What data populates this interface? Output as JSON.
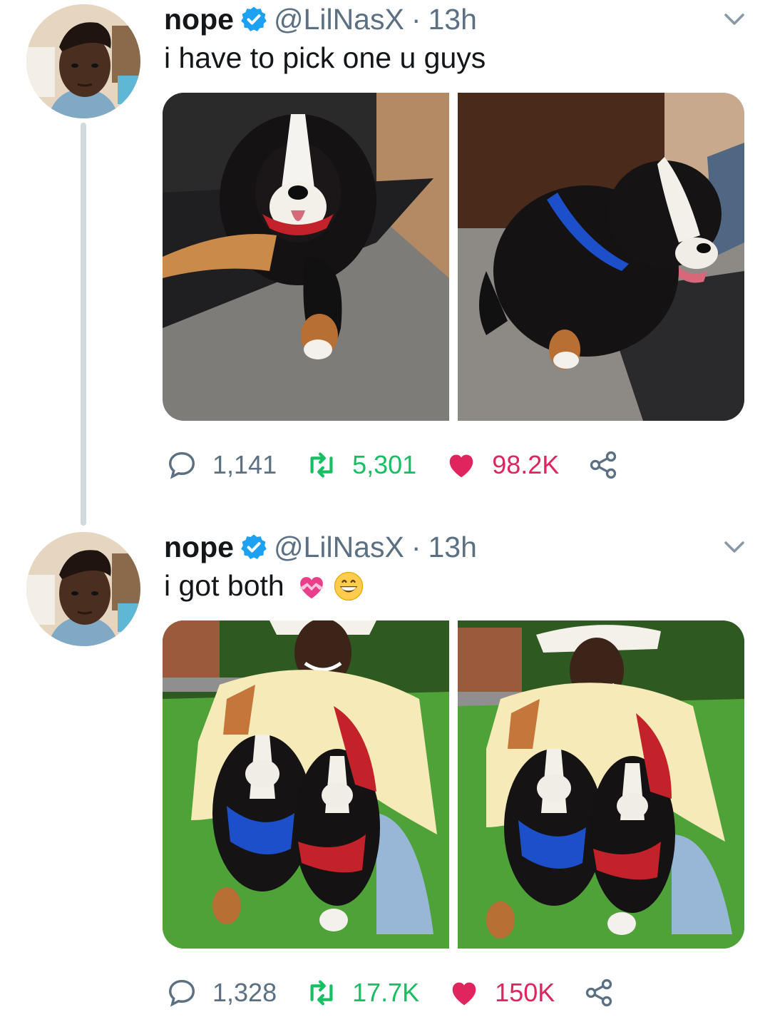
{
  "tweets": [
    {
      "display_name": "nope",
      "handle": "@LilNasX",
      "separator": "·",
      "time": "13h",
      "text": "i have to pick one u guys",
      "emojis": [],
      "photos": [
        "bernese-puppy-red-harness-lying",
        "bernese-puppy-blue-harness-sitting"
      ],
      "replies": "1,141",
      "retweets": "5,301",
      "likes": "98.2K",
      "liked": true
    },
    {
      "display_name": "nope",
      "handle": "@LilNasX",
      "separator": "·",
      "time": "13h",
      "text": "i got both",
      "emojis": [
        "heart-with-ribbon-emoji",
        "grinning-face-emoji"
      ],
      "photos": [
        "man-in-cowboy-hat-with-two-puppies",
        "man-in-cowboy-hat-with-two-puppies-2"
      ],
      "replies": "1,328",
      "retweets": "17.7K",
      "likes": "150K",
      "liked": true
    }
  ],
  "colors": {
    "verified_blue": "#1da1f2",
    "retweet_green": "#17bf63",
    "like_red": "#e0245e",
    "secondary_gray": "#5b7083",
    "thread_line": "#cfd9de"
  }
}
